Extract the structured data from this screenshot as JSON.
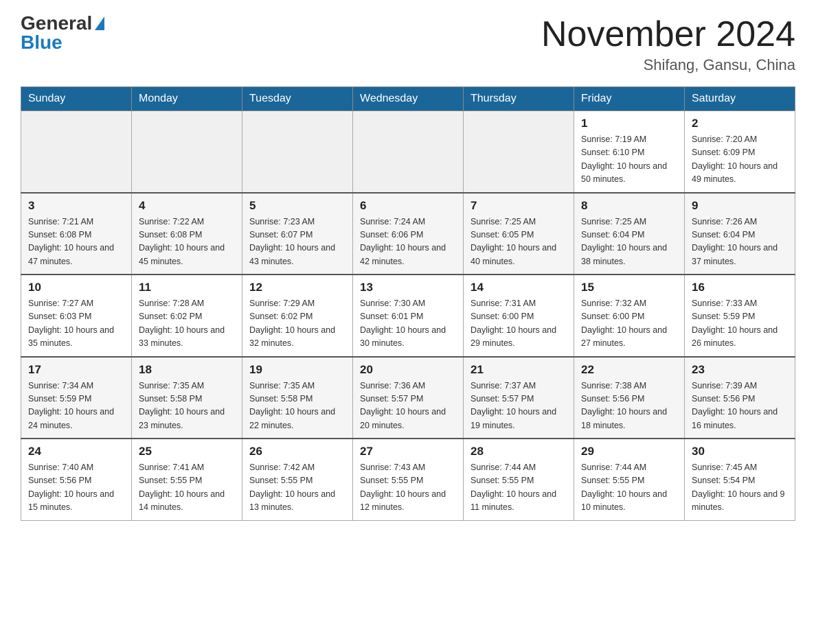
{
  "header": {
    "logo_general": "General",
    "logo_blue": "Blue",
    "month_title": "November 2024",
    "location": "Shifang, Gansu, China"
  },
  "weekdays": [
    "Sunday",
    "Monday",
    "Tuesday",
    "Wednesday",
    "Thursday",
    "Friday",
    "Saturday"
  ],
  "weeks": [
    {
      "days": [
        {
          "num": "",
          "info": ""
        },
        {
          "num": "",
          "info": ""
        },
        {
          "num": "",
          "info": ""
        },
        {
          "num": "",
          "info": ""
        },
        {
          "num": "",
          "info": ""
        },
        {
          "num": "1",
          "info": "Sunrise: 7:19 AM\nSunset: 6:10 PM\nDaylight: 10 hours and 50 minutes."
        },
        {
          "num": "2",
          "info": "Sunrise: 7:20 AM\nSunset: 6:09 PM\nDaylight: 10 hours and 49 minutes."
        }
      ]
    },
    {
      "days": [
        {
          "num": "3",
          "info": "Sunrise: 7:21 AM\nSunset: 6:08 PM\nDaylight: 10 hours and 47 minutes."
        },
        {
          "num": "4",
          "info": "Sunrise: 7:22 AM\nSunset: 6:08 PM\nDaylight: 10 hours and 45 minutes."
        },
        {
          "num": "5",
          "info": "Sunrise: 7:23 AM\nSunset: 6:07 PM\nDaylight: 10 hours and 43 minutes."
        },
        {
          "num": "6",
          "info": "Sunrise: 7:24 AM\nSunset: 6:06 PM\nDaylight: 10 hours and 42 minutes."
        },
        {
          "num": "7",
          "info": "Sunrise: 7:25 AM\nSunset: 6:05 PM\nDaylight: 10 hours and 40 minutes."
        },
        {
          "num": "8",
          "info": "Sunrise: 7:25 AM\nSunset: 6:04 PM\nDaylight: 10 hours and 38 minutes."
        },
        {
          "num": "9",
          "info": "Sunrise: 7:26 AM\nSunset: 6:04 PM\nDaylight: 10 hours and 37 minutes."
        }
      ]
    },
    {
      "days": [
        {
          "num": "10",
          "info": "Sunrise: 7:27 AM\nSunset: 6:03 PM\nDaylight: 10 hours and 35 minutes."
        },
        {
          "num": "11",
          "info": "Sunrise: 7:28 AM\nSunset: 6:02 PM\nDaylight: 10 hours and 33 minutes."
        },
        {
          "num": "12",
          "info": "Sunrise: 7:29 AM\nSunset: 6:02 PM\nDaylight: 10 hours and 32 minutes."
        },
        {
          "num": "13",
          "info": "Sunrise: 7:30 AM\nSunset: 6:01 PM\nDaylight: 10 hours and 30 minutes."
        },
        {
          "num": "14",
          "info": "Sunrise: 7:31 AM\nSunset: 6:00 PM\nDaylight: 10 hours and 29 minutes."
        },
        {
          "num": "15",
          "info": "Sunrise: 7:32 AM\nSunset: 6:00 PM\nDaylight: 10 hours and 27 minutes."
        },
        {
          "num": "16",
          "info": "Sunrise: 7:33 AM\nSunset: 5:59 PM\nDaylight: 10 hours and 26 minutes."
        }
      ]
    },
    {
      "days": [
        {
          "num": "17",
          "info": "Sunrise: 7:34 AM\nSunset: 5:59 PM\nDaylight: 10 hours and 24 minutes."
        },
        {
          "num": "18",
          "info": "Sunrise: 7:35 AM\nSunset: 5:58 PM\nDaylight: 10 hours and 23 minutes."
        },
        {
          "num": "19",
          "info": "Sunrise: 7:35 AM\nSunset: 5:58 PM\nDaylight: 10 hours and 22 minutes."
        },
        {
          "num": "20",
          "info": "Sunrise: 7:36 AM\nSunset: 5:57 PM\nDaylight: 10 hours and 20 minutes."
        },
        {
          "num": "21",
          "info": "Sunrise: 7:37 AM\nSunset: 5:57 PM\nDaylight: 10 hours and 19 minutes."
        },
        {
          "num": "22",
          "info": "Sunrise: 7:38 AM\nSunset: 5:56 PM\nDaylight: 10 hours and 18 minutes."
        },
        {
          "num": "23",
          "info": "Sunrise: 7:39 AM\nSunset: 5:56 PM\nDaylight: 10 hours and 16 minutes."
        }
      ]
    },
    {
      "days": [
        {
          "num": "24",
          "info": "Sunrise: 7:40 AM\nSunset: 5:56 PM\nDaylight: 10 hours and 15 minutes."
        },
        {
          "num": "25",
          "info": "Sunrise: 7:41 AM\nSunset: 5:55 PM\nDaylight: 10 hours and 14 minutes."
        },
        {
          "num": "26",
          "info": "Sunrise: 7:42 AM\nSunset: 5:55 PM\nDaylight: 10 hours and 13 minutes."
        },
        {
          "num": "27",
          "info": "Sunrise: 7:43 AM\nSunset: 5:55 PM\nDaylight: 10 hours and 12 minutes."
        },
        {
          "num": "28",
          "info": "Sunrise: 7:44 AM\nSunset: 5:55 PM\nDaylight: 10 hours and 11 minutes."
        },
        {
          "num": "29",
          "info": "Sunrise: 7:44 AM\nSunset: 5:55 PM\nDaylight: 10 hours and 10 minutes."
        },
        {
          "num": "30",
          "info": "Sunrise: 7:45 AM\nSunset: 5:54 PM\nDaylight: 10 hours and 9 minutes."
        }
      ]
    }
  ]
}
